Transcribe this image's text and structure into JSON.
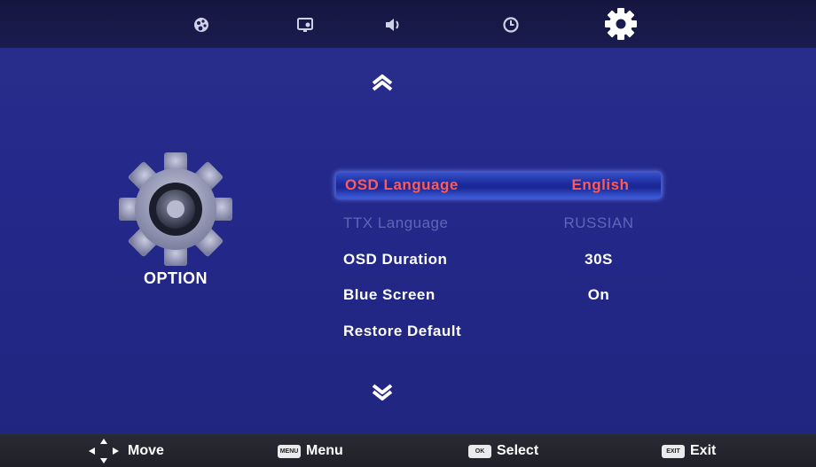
{
  "tabs": [
    {
      "icon": "picture-icon"
    },
    {
      "icon": "channel-icon"
    },
    {
      "icon": "sound-icon"
    },
    {
      "icon": "clock-icon"
    },
    {
      "icon": "gear-icon",
      "active": true
    }
  ],
  "panel": {
    "title": "OPTION",
    "icon": "gear-icon"
  },
  "menu": {
    "items": [
      {
        "label": "OSD Language",
        "value": "English",
        "state": "selected"
      },
      {
        "label": "TTX Language",
        "value": "RUSSIAN",
        "state": "disabled"
      },
      {
        "label": "OSD Duration",
        "value": "30S",
        "state": "normal"
      },
      {
        "label": "Blue Screen",
        "value": "On",
        "state": "normal"
      },
      {
        "label": "Restore Default",
        "value": "",
        "state": "normal"
      }
    ]
  },
  "footer": {
    "move": "Move",
    "menu": "Menu",
    "menu_key": "MENU",
    "select": "Select",
    "select_key": "OK",
    "exit": "Exit",
    "exit_key": "EXIT"
  },
  "colors": {
    "background": "#24288a",
    "selected_text": "#ff5a55",
    "disabled_text": "#5f66b8"
  }
}
